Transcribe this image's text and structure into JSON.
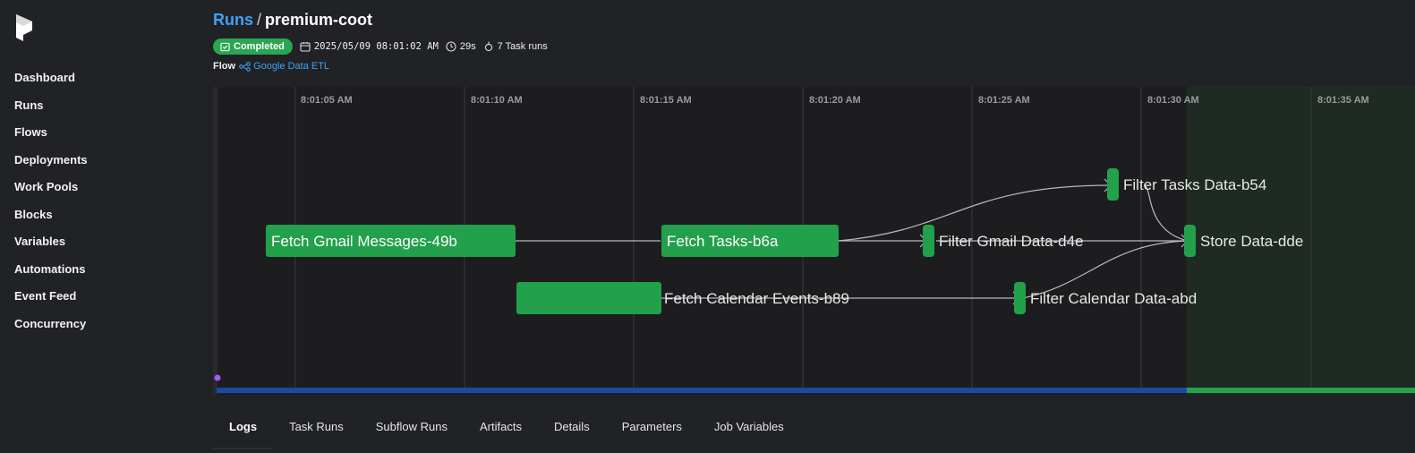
{
  "sidebar": {
    "items": [
      {
        "label": "Dashboard"
      },
      {
        "label": "Runs"
      },
      {
        "label": "Flows"
      },
      {
        "label": "Deployments"
      },
      {
        "label": "Work Pools"
      },
      {
        "label": "Blocks"
      },
      {
        "label": "Variables"
      },
      {
        "label": "Automations"
      },
      {
        "label": "Event Feed"
      },
      {
        "label": "Concurrency"
      }
    ]
  },
  "header": {
    "breadcrumb_parent": "Runs",
    "separator": "/",
    "title": "premium-coot",
    "status": "Completed",
    "start_time": "2025/05/09 08:01:02 AM",
    "duration": "29s",
    "task_runs": "7 Task runs",
    "flow_label": "Flow",
    "flow_name": "Google Data ETL"
  },
  "timeline": {
    "ticks": [
      "8:01:05 AM",
      "8:01:10 AM",
      "8:01:15 AM",
      "8:01:20 AM",
      "8:01:25 AM",
      "8:01:30 AM",
      "8:01:35 AM"
    ],
    "nodes": [
      {
        "label": "Fetch Gmail Messages-49b",
        "name": "node-fetch-gmail"
      },
      {
        "label": "Fetch Tasks-b6a",
        "name": "node-fetch-tasks"
      },
      {
        "label": "Fetch Calendar Events-b89",
        "name": "node-fetch-calendar"
      },
      {
        "label": "Filter Gmail Data-d4e",
        "name": "node-filter-gmail"
      },
      {
        "label": "Filter Tasks Data-b54",
        "name": "node-filter-tasks"
      },
      {
        "label": "Filter Calendar Data-abd",
        "name": "node-filter-calendar"
      },
      {
        "label": "Store Data-dde",
        "name": "node-store-data"
      }
    ],
    "colors": {
      "node": "#23a04b",
      "progress": "#1b48a3",
      "progress_done": "#22a24c",
      "marker": "#a259ff"
    }
  },
  "tabs": [
    {
      "label": "Logs",
      "active": true
    },
    {
      "label": "Task Runs"
    },
    {
      "label": "Subflow Runs"
    },
    {
      "label": "Artifacts"
    },
    {
      "label": "Details"
    },
    {
      "label": "Parameters"
    },
    {
      "label": "Job Variables"
    }
  ]
}
